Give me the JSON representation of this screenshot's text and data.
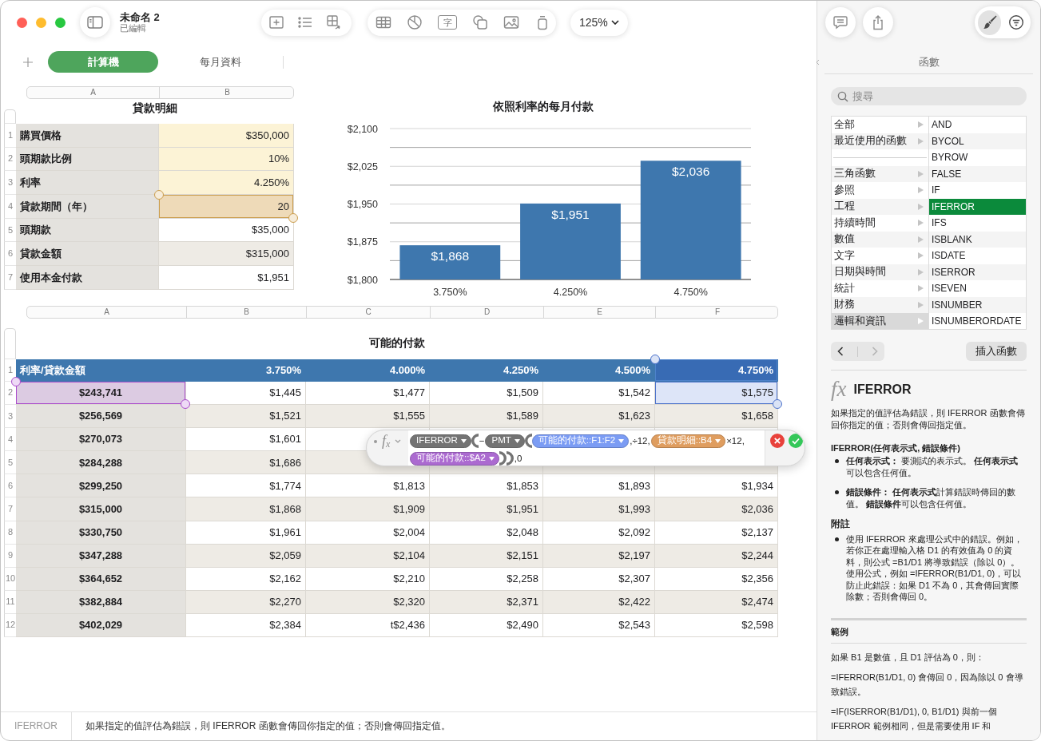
{
  "window": {
    "title": "未命名 2",
    "subtitle": "已編輯"
  },
  "toolbar": {
    "text_tool_label": "字",
    "zoom": "125%"
  },
  "inspector_tabs": [
    {
      "kind": "format",
      "selected": true
    },
    {
      "kind": "organize",
      "selected": false
    }
  ],
  "sheet_tabs": [
    {
      "label": "計算機",
      "selected": true
    },
    {
      "label": "每月資料",
      "selected": false
    }
  ],
  "loan_table": {
    "title": "貸款明細",
    "columns": [
      "A",
      "B"
    ],
    "rows": [
      {
        "number": "1",
        "kind": "input",
        "cells": [
          "購買價格",
          "$350,000"
        ]
      },
      {
        "number": "2",
        "kind": "input",
        "cells": [
          "頭期款比例",
          "10%"
        ]
      },
      {
        "number": "3",
        "kind": "input",
        "cells": [
          "利率",
          "4.250%"
        ]
      },
      {
        "number": "4",
        "kind": "input",
        "cells": [
          "貸款期間（年）",
          {
            "text": "20",
            "color": "#eedab8"
          }
        ]
      },
      {
        "number": "5",
        "kind": "calc",
        "cells": [
          "頭期款",
          "$35,000"
        ]
      },
      {
        "number": "6",
        "kind": "calc",
        "cells": [
          "貸款金額",
          "$315,000"
        ]
      },
      {
        "number": "7",
        "kind": "calc",
        "cells": [
          "使用本金付款",
          "$1,951"
        ]
      }
    ]
  },
  "chart": {
    "chart_data": {
      "type": "bar",
      "title": "依照利率的每月付款",
      "categories": [
        "3.750%",
        "4.250%",
        "4.750%"
      ],
      "series": [
        {
          "color": "#3e77ae",
          "values": [
            1868,
            1951,
            2036
          ]
        }
      ],
      "ylim": [
        1800,
        2100
      ],
      "yticks": [
        {
          "value": 1800,
          "label": "$1,800"
        },
        {
          "value": 1875,
          "label": "$1,875"
        },
        {
          "value": 1950,
          "label": "$1,950"
        },
        {
          "value": 2025,
          "label": "$2,025"
        },
        {
          "value": 2100,
          "label": "$2,100"
        }
      ],
      "grid": true,
      "value_labels": [
        "$1,868",
        "$1,951",
        "$2,036"
      ]
    }
  },
  "payments_table": {
    "title": "可能的付款",
    "columns": [
      "A",
      "B",
      "C",
      "D",
      "E",
      "F"
    ],
    "rows": [
      {
        "number": "1",
        "kind": "header",
        "cells": [
          "利率/貸款金額",
          "3.750%",
          "4.000%",
          "4.250%",
          "4.500%",
          {
            "text": "4.750%",
            "color": "#386bb4"
          }
        ]
      },
      {
        "number": "2",
        "kind": "body",
        "cells": [
          {
            "text": "$243,741",
            "color": "#dccbe2"
          },
          "$1,445",
          "$1,477",
          "$1,509",
          "$1,542",
          {
            "text": "$1,575",
            "color": "#dde5f8"
          }
        ]
      },
      {
        "number": "3",
        "kind": "body",
        "cells": [
          "$256,569",
          "$1,521",
          "$1,555",
          "$1,589",
          "$1,623",
          "$1,658"
        ]
      },
      {
        "number": "4",
        "kind": "body",
        "cells": [
          "$270,073",
          "$1,601"
        ]
      },
      {
        "number": "5",
        "kind": "body",
        "cells": [
          "$284,288",
          "$1,686"
        ]
      },
      {
        "number": "6",
        "kind": "body",
        "cells": [
          "$299,250",
          "$1,774",
          "$1,813",
          "$1,853",
          "$1,893",
          "$1,934"
        ]
      },
      {
        "number": "7",
        "kind": "body",
        "cells": [
          "$315,000",
          "$1,868",
          "$1,909",
          "$1,951",
          "$1,993",
          "$2,036"
        ]
      },
      {
        "number": "8",
        "kind": "body",
        "cells": [
          "$330,750",
          "$1,961",
          "$2,004",
          "$2,048",
          "$2,092",
          "$2,137"
        ]
      },
      {
        "number": "9",
        "kind": "body",
        "cells": [
          "$347,288",
          "$2,059",
          "$2,104",
          "$2,151",
          "$2,197",
          "$2,244"
        ]
      },
      {
        "number": "10",
        "kind": "body",
        "cells": [
          "$364,652",
          "$2,162",
          "$2,210",
          "$2,258",
          "$2,307",
          "$2,356"
        ]
      },
      {
        "number": "11",
        "kind": "body",
        "cells": [
          "$382,884",
          "$2,270",
          "$2,320",
          "$2,371",
          "$2,422",
          "$2,474"
        ]
      },
      {
        "number": "12",
        "kind": "body",
        "cells": [
          "$402,029",
          "$2,384",
          "t$2,436",
          "$2,490",
          "$2,543",
          "$2,598"
        ]
      }
    ]
  },
  "formula_editor": {
    "symbol": "f$_{x}$",
    "tokens": [
      {
        "kind": "function",
        "text": "IFERROR"
      },
      {
        "kind": "open"
      },
      {
        "kind": "operator",
        "text": "−"
      },
      {
        "kind": "function",
        "text": "PMT"
      },
      {
        "kind": "open"
      },
      {
        "kind": "reference",
        "text": "可能的付款::F1:F2",
        "color": "#7b9cf4"
      },
      {
        "kind": "operator",
        "text": ",÷12,"
      },
      {
        "kind": "reference",
        "text": "貸款明細::B4",
        "color": "#df9d5f"
      },
      {
        "kind": "operator",
        "text": "×12,"
      },
      {
        "kind": "reference",
        "text": "可能的付款::$A2",
        "color": "#ab6ad0"
      },
      {
        "kind": "close"
      },
      {
        "kind": "close"
      },
      {
        "kind": "operator",
        "text": ",0"
      }
    ]
  },
  "function_browser": {
    "title": "函數",
    "search": {
      "placeholder": "搜尋"
    },
    "categories": [
      {
        "kind": "category",
        "label": "全部",
        "selected": false
      },
      {
        "kind": "category",
        "label": "最近使用的函數",
        "selected": false
      },
      {
        "kind": "separator"
      },
      {
        "kind": "category",
        "label": "三角函數",
        "selected": false
      },
      {
        "kind": "category",
        "label": "參照",
        "selected": false
      },
      {
        "kind": "category",
        "label": "工程",
        "selected": false
      },
      {
        "kind": "category",
        "label": "持續時間",
        "selected": false
      },
      {
        "kind": "category",
        "label": "數值",
        "selected": false
      },
      {
        "kind": "category",
        "label": "文字",
        "selected": false
      },
      {
        "kind": "category",
        "label": "日期與時間",
        "selected": false
      },
      {
        "kind": "category",
        "label": "統計",
        "selected": false
      },
      {
        "kind": "category",
        "label": "財務",
        "selected": false
      },
      {
        "kind": "category",
        "label": "邏輯和資訊",
        "selected": true
      }
    ],
    "functions": [
      {
        "label": "AND",
        "selected": false
      },
      {
        "label": "BYCOL",
        "selected": false
      },
      {
        "label": "BYROW",
        "selected": false
      },
      {
        "label": "FALSE",
        "selected": false
      },
      {
        "label": "IF",
        "selected": false
      },
      {
        "label": "IFERROR",
        "selected": true
      },
      {
        "label": "IFS",
        "selected": false
      },
      {
        "label": "ISBLANK",
        "selected": false
      },
      {
        "label": "ISDATE",
        "selected": false
      },
      {
        "label": "ISERROR",
        "selected": false
      },
      {
        "label": "ISEVEN",
        "selected": false
      },
      {
        "label": "ISNUMBER",
        "selected": false
      },
      {
        "label": "ISNUMBERORDATE",
        "selected": false
      }
    ],
    "history_buttons": [
      {
        "kind": "back",
        "disabled": false
      },
      {
        "kind": "forward",
        "disabled": true
      }
    ],
    "insert_button": "插入函數"
  },
  "function_help": {
    "symbol": "fx",
    "name": "IFERROR",
    "description": "如果指定的值評估為錯誤，則 IFERROR 函數會傳回你指定的值；否則會傳回指定值。",
    "syntax": "IFERROR(任何表示式, 錯誤條件)",
    "arguments": [
      "**任何表示式：** 要測試的表示式。 **任何表示式**可以包含任何值。",
      "**錯誤條件： 任何表示式**計算錯誤時傳回的數值。 **錯誤條件**可以包含任何值。"
    ],
    "notes_title": "附註",
    "notes": [
      "使用 IFERROR 來處理公式中的錯誤。例如，若你正在處理輸入格 D1 的有效值為 0 的資料，則公式 =B1/D1 將導致錯誤（除以 0）。使用公式，例如 =IFERROR(B1/D1, 0)，可以防止此錯誤：如果 D1 不為 0，其會傳回實際除數；否則會傳回 0。"
    ],
    "examples_title": "範例",
    "examples": [
      "如果 B1 是數值，且 D1 評估為 0，則：",
      "=IFERROR(B1/D1, 0) 會傳回 0，因為除以 0 會導致錯誤。",
      "=IF(ISERROR(B1/D1), 0, B1/D1) 與前一個 IFERROR 範例相同，但是需要使用 IF 和"
    ]
  },
  "status_bar": {
    "function_name": "IFERROR",
    "description": "如果指定的值評估為錯誤，則 IFERROR 函數會傳回你指定的值；否則會傳回指定值。"
  }
}
